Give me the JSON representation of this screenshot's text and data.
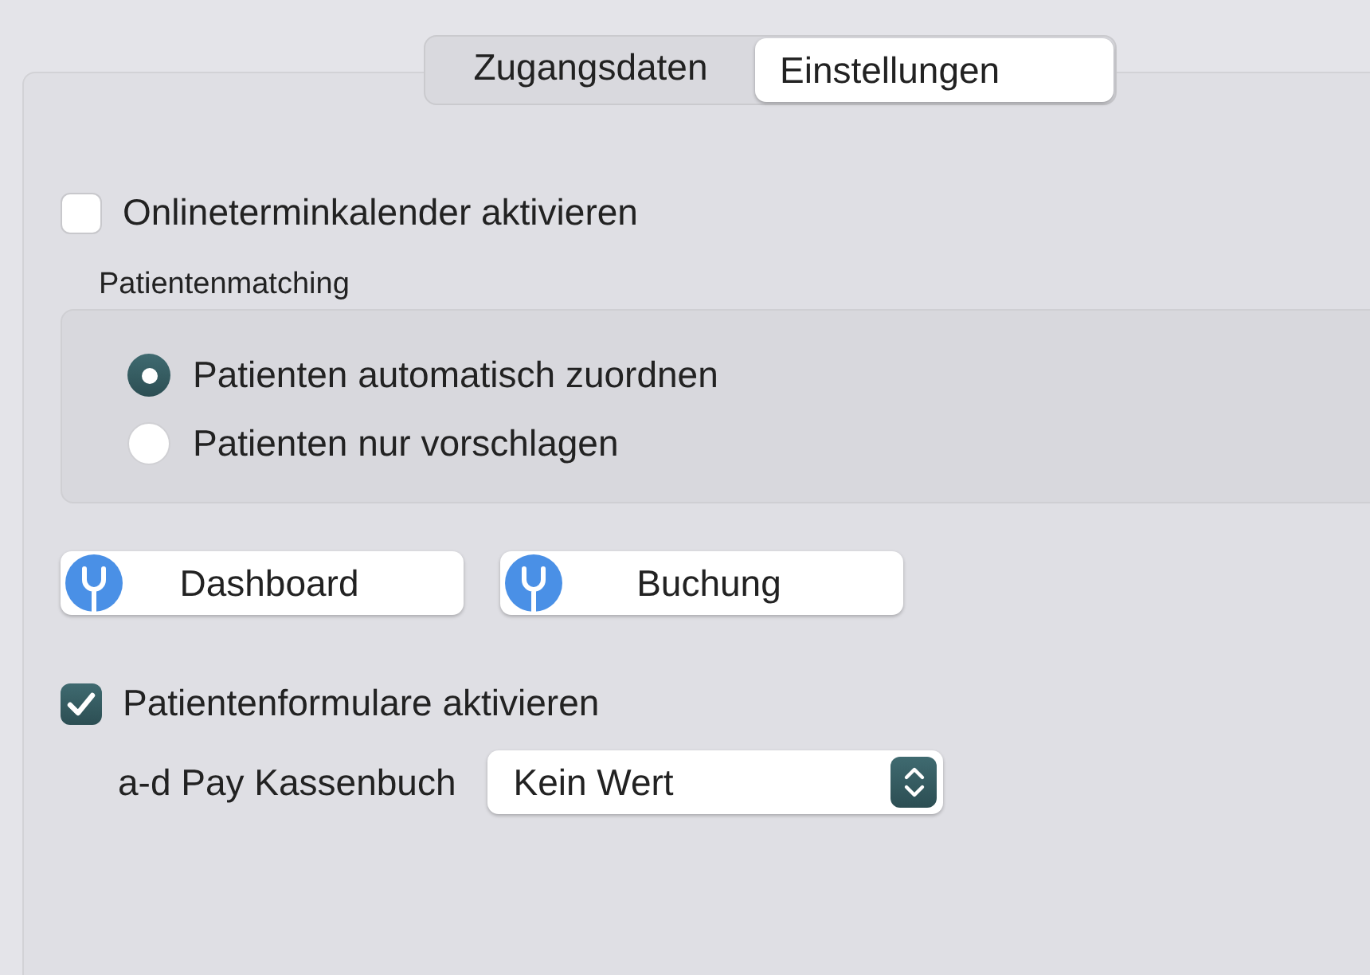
{
  "tabs": [
    {
      "label": "Zugangsdaten",
      "selected": false
    },
    {
      "label": "Einstellungen",
      "selected": true
    }
  ],
  "online_calendar": {
    "label": "Onlineterminkalender aktivieren",
    "checked": false
  },
  "patient_matching": {
    "title": "Patientenmatching",
    "options": [
      {
        "label": "Patienten automatisch zuordnen",
        "selected": true
      },
      {
        "label": "Patienten nur vorschlagen",
        "selected": false
      }
    ]
  },
  "buttons": [
    {
      "label": "Dashboard"
    },
    {
      "label": "Buchung"
    }
  ],
  "patient_forms": {
    "label": "Patientenformulare aktivieren",
    "checked": true
  },
  "cashbook": {
    "label": "a-d Pay Kassenbuch",
    "value": "Kein Wert"
  }
}
